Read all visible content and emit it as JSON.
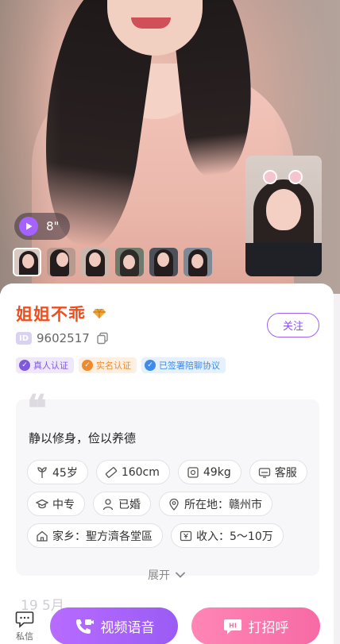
{
  "profile": {
    "duration": "8\"",
    "name": "姐姐不乖",
    "id": "9602517",
    "id_tag": "ID",
    "follow_label": "关注"
  },
  "badges": [
    {
      "label": "真人认证",
      "icon": "verified-icon",
      "color": "#7f5bdc"
    },
    {
      "label": "实名认证",
      "icon": "id-card-icon",
      "color": "#ee8a2d"
    },
    {
      "label": "已签署陪聊协议",
      "icon": "agreement-icon",
      "color": "#3d8ce8"
    }
  ],
  "info": {
    "quote_mark": "❝",
    "motto": "静以修身，俭以养德",
    "tags": [
      {
        "label": "45岁",
        "icon": "age-icon"
      },
      {
        "label": "160cm",
        "icon": "height-icon"
      },
      {
        "label": "49kg",
        "icon": "weight-icon"
      },
      {
        "label": "客服",
        "icon": "job-icon"
      },
      {
        "label": "中专",
        "icon": "education-icon"
      },
      {
        "label": "已婚",
        "icon": "person-icon"
      },
      {
        "label": "所在地：赣州市",
        "icon": "location-icon"
      },
      {
        "label": "家乡：聖方濟各堂區",
        "icon": "home-icon"
      },
      {
        "label": "收入：5～10万",
        "icon": "income-icon"
      }
    ],
    "expand_label": "展开"
  },
  "faint_date": "19 5月",
  "bottom": {
    "message_label": "私信",
    "video_label": "视频语音",
    "greet_label": "打招呼",
    "greet_icon_text": "HI"
  },
  "colors": {
    "accent_purple": "#9a5cf5",
    "accent_pink": "#f76aa5",
    "name_orange": "#f04d1d"
  }
}
